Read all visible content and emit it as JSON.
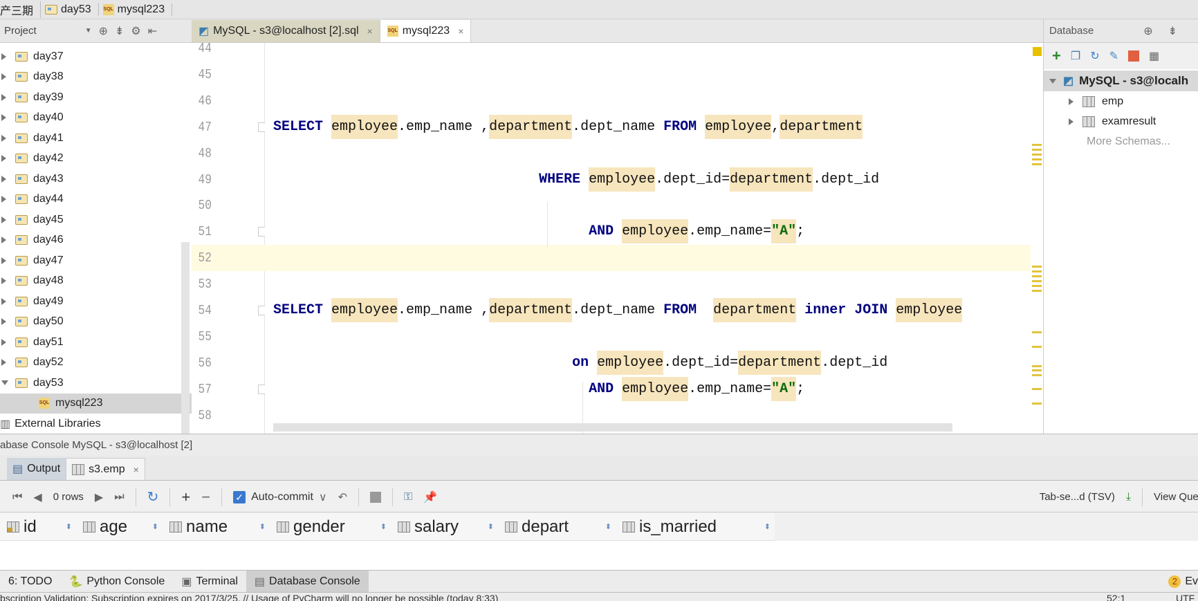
{
  "breadcrumb": [
    "产三期",
    "day53",
    "mysql223"
  ],
  "project_panel": {
    "title": "Project"
  },
  "editor_tabs": [
    {
      "label": "MySQL - s3@localhost [2].sql",
      "active": false
    },
    {
      "label": "mysql223",
      "active": true
    }
  ],
  "project_tree": {
    "folders": [
      "day37",
      "day38",
      "day39",
      "day40",
      "day41",
      "day42",
      "day43",
      "day44",
      "day45",
      "day46",
      "day47",
      "day48",
      "day49",
      "day50",
      "day51",
      "day52",
      "day53"
    ],
    "selected_file": "mysql223",
    "external": "External Libraries"
  },
  "editor": {
    "current_line": 52,
    "lines": [
      {
        "n": 44,
        "tokens": []
      },
      {
        "n": 45,
        "tokens": []
      },
      {
        "n": 46,
        "tokens": []
      },
      {
        "n": 47,
        "tokens": [
          [
            "kw",
            "SELECT"
          ],
          [
            "tx",
            " "
          ],
          [
            "tb",
            "employee"
          ],
          [
            "tx",
            ".emp_name ,"
          ],
          [
            "tb",
            "department"
          ],
          [
            "tx",
            ".dept_name "
          ],
          [
            "kw",
            "FROM"
          ],
          [
            "tx",
            " "
          ],
          [
            "tb",
            "employee"
          ],
          [
            "tx",
            ","
          ],
          [
            "tb",
            "department"
          ]
        ]
      },
      {
        "n": 48,
        "tokens": []
      },
      {
        "n": 49,
        "tokens": [
          [
            "tx",
            "                                "
          ],
          [
            "kw",
            "WHERE"
          ],
          [
            "tx",
            " "
          ],
          [
            "tb",
            "employee"
          ],
          [
            "tx",
            ".dept_id="
          ],
          [
            "tb",
            "department"
          ],
          [
            "tx",
            ".dept_id"
          ]
        ]
      },
      {
        "n": 50,
        "tokens": []
      },
      {
        "n": 51,
        "tokens": [
          [
            "tx",
            "                                      "
          ],
          [
            "kw",
            "AND"
          ],
          [
            "tx",
            " "
          ],
          [
            "tb",
            "employee"
          ],
          [
            "tx",
            ".emp_name="
          ],
          [
            "st",
            "\"A\""
          ],
          [
            "tx",
            ";"
          ]
        ]
      },
      {
        "n": 52,
        "tokens": []
      },
      {
        "n": 53,
        "tokens": []
      },
      {
        "n": 54,
        "tokens": [
          [
            "kw",
            "SELECT"
          ],
          [
            "tx",
            " "
          ],
          [
            "tb",
            "employee"
          ],
          [
            "tx",
            ".emp_name ,"
          ],
          [
            "tb",
            "department"
          ],
          [
            "tx",
            ".dept_name "
          ],
          [
            "kw",
            "FROM"
          ],
          [
            "tx",
            "  "
          ],
          [
            "tb",
            "department"
          ],
          [
            "tx",
            " "
          ],
          [
            "kw",
            "inner"
          ],
          [
            "tx",
            " "
          ],
          [
            "kw",
            "JOIN"
          ],
          [
            "tx",
            " "
          ],
          [
            "tb",
            "employee"
          ]
        ]
      },
      {
        "n": 55,
        "tokens": []
      },
      {
        "n": 56,
        "tokens": [
          [
            "tx",
            "                                    "
          ],
          [
            "kw",
            "on"
          ],
          [
            "tx",
            " "
          ],
          [
            "tb",
            "employee"
          ],
          [
            "tx",
            ".dept_id="
          ],
          [
            "tb",
            "department"
          ],
          [
            "tx",
            ".dept_id"
          ]
        ]
      },
      {
        "n": 57,
        "tokens": [
          [
            "tx",
            "                                      "
          ],
          [
            "kw",
            "AND"
          ],
          [
            "tx",
            " "
          ],
          [
            "tb",
            "employee"
          ],
          [
            "tx",
            ".emp_name="
          ],
          [
            "st",
            "\"A\""
          ],
          [
            "tx",
            ";"
          ]
        ]
      },
      {
        "n": 58,
        "tokens": []
      }
    ]
  },
  "database_panel": {
    "title": "Database",
    "connection": "MySQL - s3@localh",
    "tables": [
      "emp",
      "examresult"
    ],
    "more": "More Schemas..."
  },
  "console": {
    "title": "abase Console MySQL - s3@localhost [2]",
    "tabs": [
      "Output",
      "s3.emp"
    ],
    "rows_label": "0 rows",
    "autocommit_label": "Auto-commit",
    "autocommit_checked": true,
    "export_format": "Tab-se...d (TSV)",
    "view_query": "View Que",
    "columns": [
      "id",
      "age",
      "name",
      "gender",
      "salary",
      "depart",
      "is_married"
    ]
  },
  "tool_tabs": [
    "6: TODO",
    "Python Console",
    "Terminal",
    "Database Console"
  ],
  "event_log": {
    "count": "2",
    "label": "Ev"
  },
  "status": {
    "message": "bscription Validation: Subscription expires on 2017/3/25. // Usage of PyCharm will no longer be possible (today 8:33)",
    "position": "52:1",
    "encoding": "UTF"
  },
  "colors": {
    "keyword": "#000080",
    "table_highlight": "#f7e5bd",
    "current_line": "#fffbe0"
  }
}
